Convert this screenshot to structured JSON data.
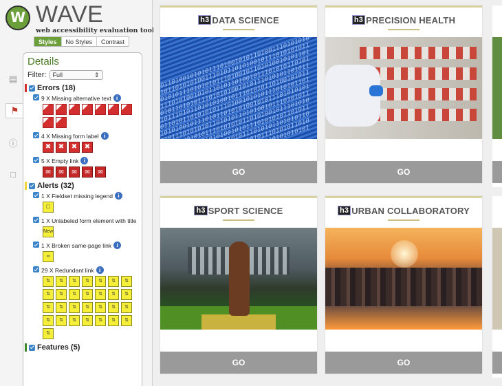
{
  "wave": {
    "logo_word": "WAVE",
    "tagline": "web accessibility evaluation tool",
    "style_options": [
      "Styles",
      "No Styles",
      "Contrast"
    ],
    "details_title": "Details",
    "filter_label": "Filter:",
    "filter_value": "Full",
    "categories": {
      "errors": {
        "label": "Errors (18)",
        "color": "#d32f2f"
      },
      "alerts": {
        "label": "Alerts (32)",
        "color": "#f3d23b"
      },
      "features": {
        "label": "Features (5)",
        "color": "#3c8b28"
      }
    },
    "items": {
      "missing_alt": "9 X Missing alternative text",
      "missing_form_label": "4 X Missing form label",
      "empty_link": "5 X Empty link",
      "fieldset_missing_legend": "1 X Fieldset missing legend",
      "unlabeled_form_element": "1 X Unlabeled form element with title",
      "broken_same_page_link": "1 X Broken same-page link",
      "redundant_link": "29 X Redundant link"
    },
    "icon_counts": {
      "missing_alt": 9,
      "missing_form_label": 4,
      "empty_link": 5,
      "redundant_link": 29
    },
    "alert_icon_labels": {
      "unlabeled_form_element": "New"
    }
  },
  "cards": [
    {
      "h3": "h3",
      "title": "DATA SCIENCE",
      "button": "GO"
    },
    {
      "h3": "h3",
      "title": "PRECISION HEALTH",
      "button": "GO"
    },
    {
      "h3": "h3",
      "title": "SPORT SCIENCE",
      "button": "GO"
    },
    {
      "h3": "h3",
      "title": "URBAN COLLABORATORY",
      "button": "GO"
    }
  ]
}
